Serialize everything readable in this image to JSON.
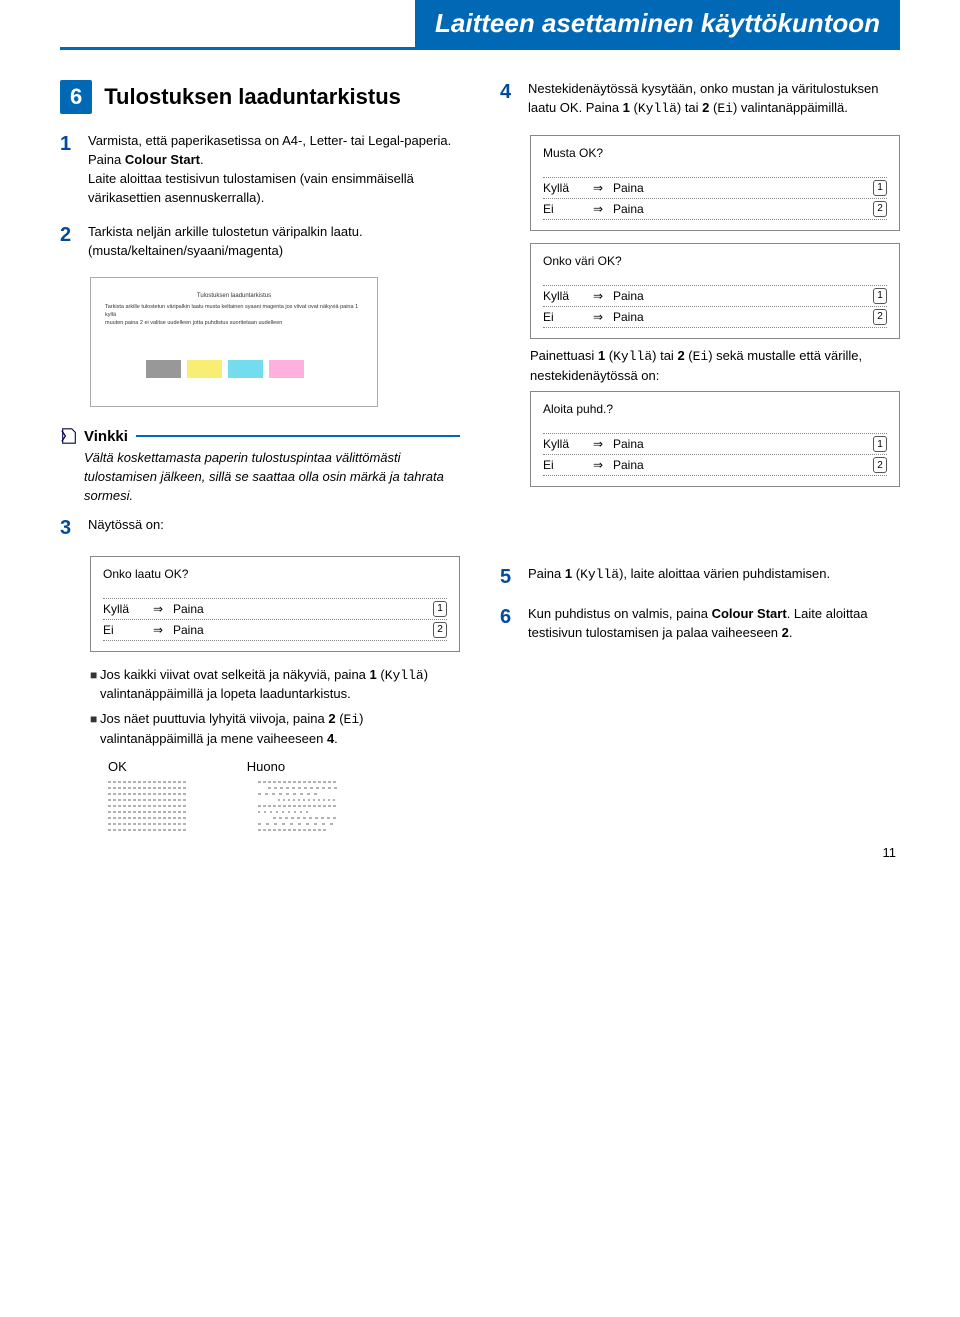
{
  "pageTitle": "Laitteen asettaminen käyttökuntoon",
  "section": {
    "num": "6",
    "title": "Tulostuksen laaduntarkistus"
  },
  "step1": {
    "num": "1",
    "a": "Varmista, että paperikasetissa on A4-, Letter- tai Legal-paperia.",
    "b1": "Paina ",
    "b2": "Colour Start",
    "b3": ".",
    "c": "Laite aloittaa testisivun tulostamisen (vain ensimmäisellä värikasettien asennuskerralla)."
  },
  "step2": {
    "num": "2",
    "a": "Tarkista neljän arkille tulostetun väripalkin laatu.",
    "b": "(musta/keltainen/syaani/magenta)"
  },
  "noteLabel": "Vinkki",
  "noteBody": "Vältä koskettamasta paperin tulostuspintaa välittömästi tulostamisen jälkeen, sillä se saattaa olla osin märkä ja tahrata sormesi.",
  "step3": {
    "num": "3",
    "a": "Näytössä on:"
  },
  "lcd3": {
    "title": "Onko laatu OK?",
    "r1": {
      "lbl": "Kyllä",
      "arr": "⇒",
      "act": "Paina",
      "key": "1"
    },
    "r2": {
      "lbl": "Ei",
      "arr": "⇒",
      "act": "Paina",
      "key": "2"
    }
  },
  "bullets": {
    "b1a": "Jos kaikki viivat ovat selkeitä ja näkyviä, paina ",
    "b1b": "1",
    "b1c": " (",
    "b1d": "Kyllä",
    "b1e": ") valintanäppäimillä ja lopeta laaduntarkistus.",
    "b2a": "Jos näet puuttuvia lyhyitä viivoja, paina ",
    "b2b": "2",
    "b2c": " (",
    "b2d": "Ei",
    "b2e": ") valintanäppäimillä ja mene vaiheeseen ",
    "b2f": "4",
    "b2g": "."
  },
  "okbad": {
    "ok": "OK",
    "bad": "Huono"
  },
  "step4": {
    "num": "4",
    "a1": "Nestekidenäytössä kysytään, onko mustan ja väritulostuksen laatu OK. Paina ",
    "a2": "1",
    "a3": " (",
    "a4": "Kyllä",
    "a5": ") tai ",
    "a6": "2",
    "a7": " (",
    "a8": "Ei",
    "a9": ") valintanäppäimillä."
  },
  "lcd4a": {
    "title": "Musta OK?"
  },
  "lcd4b": {
    "title": "Onko väri OK?"
  },
  "after4": {
    "a1": "Painettuasi ",
    "a2": "1",
    "a3": " (",
    "a4": "Kyllä",
    "a5": ") tai ",
    "a6": "2",
    "a7": " (",
    "a8": "Ei",
    "a9": ") sekä mustalle että värille, nestekidenäytössä on:"
  },
  "lcd4c": {
    "title": "Aloita puhd.?"
  },
  "step5": {
    "num": "5",
    "a1": "Paina ",
    "a2": "1",
    "a3": " (",
    "a4": "Kyllä",
    "a5": "), laite aloittaa värien puhdistamisen."
  },
  "step6": {
    "num": "6",
    "a1": "Kun puhdistus on valmis, paina ",
    "a2": "Colour Start",
    "a3": ". Laite aloittaa testisivun tulostamisen ja palaa vaiheeseen ",
    "a4": "2",
    "a5": "."
  },
  "kv": {
    "kylla": "Kyllä",
    "ei": "Ei",
    "arr": "⇒",
    "paina": "Paina",
    "k1": "1",
    "k2": "2"
  },
  "pageNum": "11"
}
